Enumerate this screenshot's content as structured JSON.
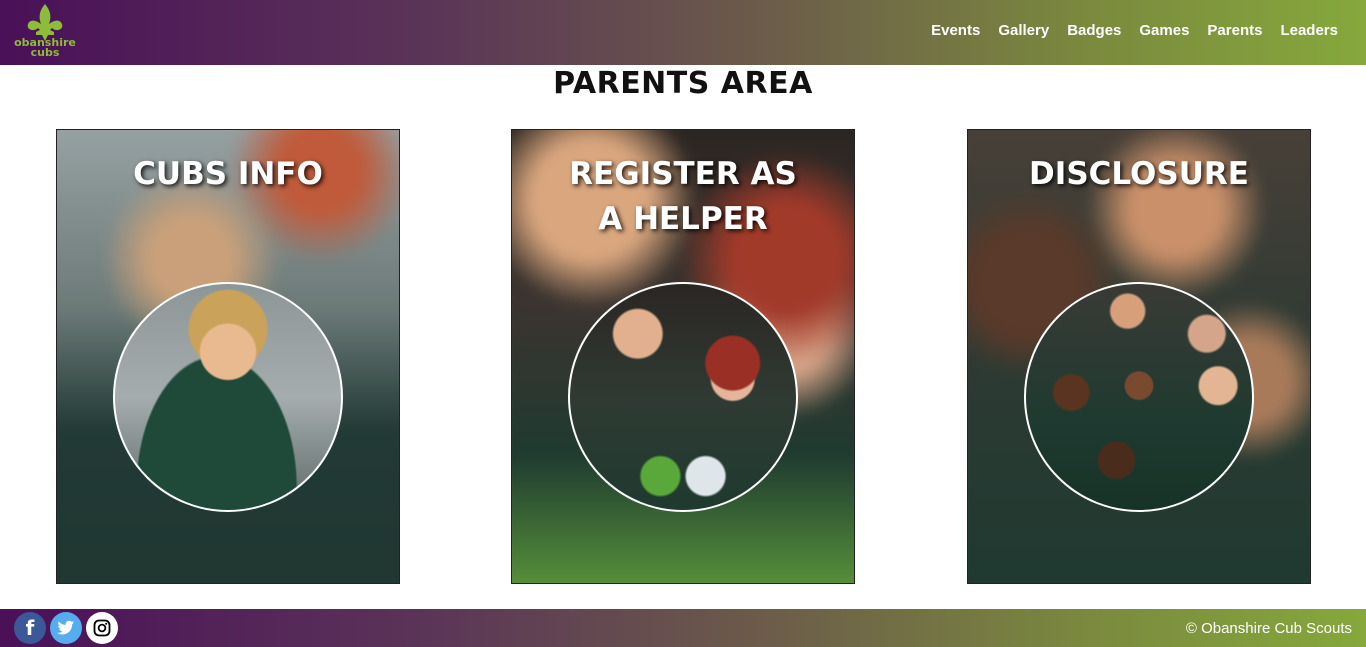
{
  "site": {
    "logo_text_line1": "obanshire",
    "logo_text_line2": "cubs"
  },
  "nav": {
    "items": [
      {
        "label": "Events"
      },
      {
        "label": "Gallery"
      },
      {
        "label": "Badges"
      },
      {
        "label": "Games"
      },
      {
        "label": "Parents"
      },
      {
        "label": "Leaders"
      }
    ]
  },
  "main": {
    "title": "PARENTS AREA",
    "cards": [
      {
        "title": "CUBS INFO"
      },
      {
        "title": "REGISTER AS A HELPER"
      },
      {
        "title": "DISCLOSURE"
      }
    ]
  },
  "footer": {
    "social": [
      {
        "icon": "facebook-icon",
        "glyph": "f"
      },
      {
        "icon": "twitter-icon",
        "glyph": "🐦"
      },
      {
        "icon": "instagram-icon",
        "glyph": ""
      }
    ],
    "copyright": "© Obanshire Cub Scouts"
  },
  "colors": {
    "brand_purple": "#4a1058",
    "brand_green": "#86a83c",
    "logo_green": "#8dbb3a"
  }
}
